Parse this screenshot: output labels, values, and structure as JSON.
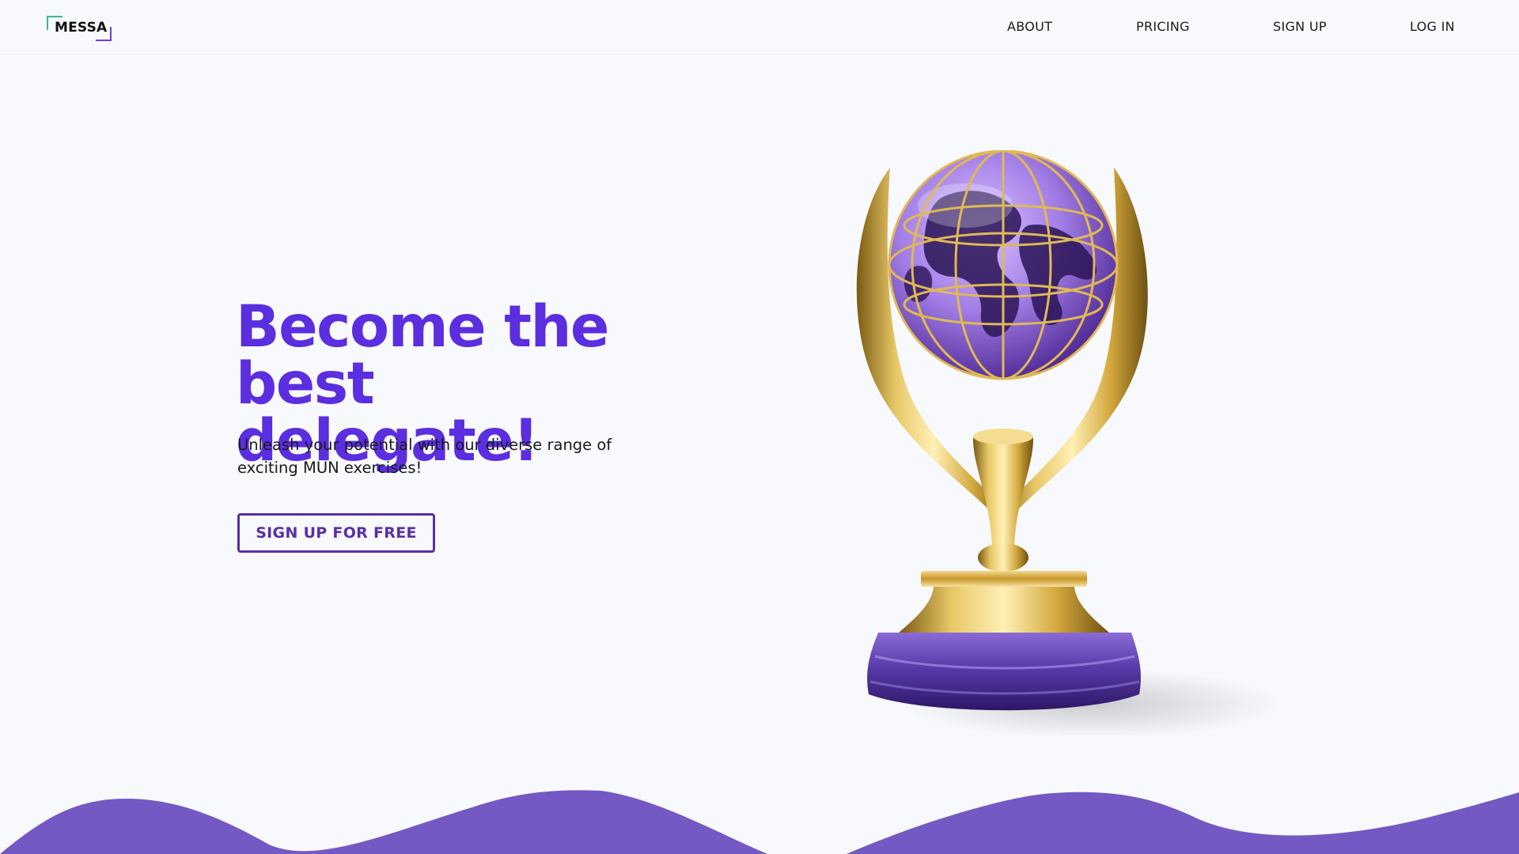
{
  "header": {
    "logo": "MESSA",
    "nav": [
      {
        "label": "ABOUT"
      },
      {
        "label": "PRICING"
      },
      {
        "label": "SIGN UP"
      },
      {
        "label": "LOG IN"
      }
    ]
  },
  "hero": {
    "title_line1": "Become the",
    "title_line2": "best delegate!",
    "subtitle": "Unleash your potential with our diverse range of exciting MUN exercises!",
    "cta_label": "SIGN UP FOR FREE"
  },
  "colors": {
    "accent": "#5b2ee0",
    "button_border": "#5b2ea6",
    "wave": "#7459c4",
    "logo_corner_top_left": "#3bb89a",
    "logo_corner_bottom_right": "#6b3fd6",
    "background": "#f7f9fc"
  },
  "image": {
    "icon": "globe-trophy-icon"
  }
}
